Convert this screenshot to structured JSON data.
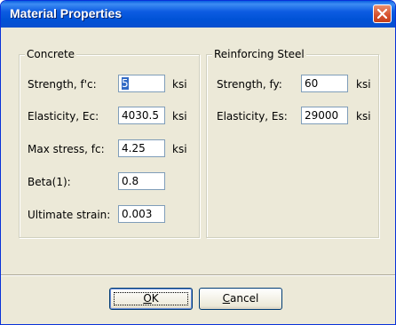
{
  "window": {
    "title": "Material Properties",
    "close_icon": "close-icon"
  },
  "concrete": {
    "legend": "Concrete",
    "fields": [
      {
        "label": "Strength, f'c:",
        "value": "5",
        "unit": "ksi"
      },
      {
        "label": "Elasticity, Ec:",
        "value": "4030.5",
        "unit": "ksi"
      },
      {
        "label": "Max stress, fc:",
        "value": "4.25",
        "unit": "ksi"
      },
      {
        "label": "Beta(1):",
        "value": "0.8",
        "unit": ""
      },
      {
        "label": "Ultimate strain:",
        "value": "0.003",
        "unit": ""
      }
    ]
  },
  "steel": {
    "legend": "Reinforcing Steel",
    "fields": [
      {
        "label": "Strength, fy:",
        "value": "60",
        "unit": "ksi"
      },
      {
        "label": "Elasticity, Es:",
        "value": "29000",
        "unit": "ksi"
      }
    ]
  },
  "buttons": {
    "ok": {
      "mnemonic": "O",
      "rest": "K"
    },
    "cancel": {
      "mnemonic": "C",
      "rest": "ancel"
    }
  },
  "colors": {
    "titlebar": "#0052d6",
    "dialog_bg": "#ece9d8",
    "close_button": "#d6502c",
    "selection": "#316ac5"
  }
}
